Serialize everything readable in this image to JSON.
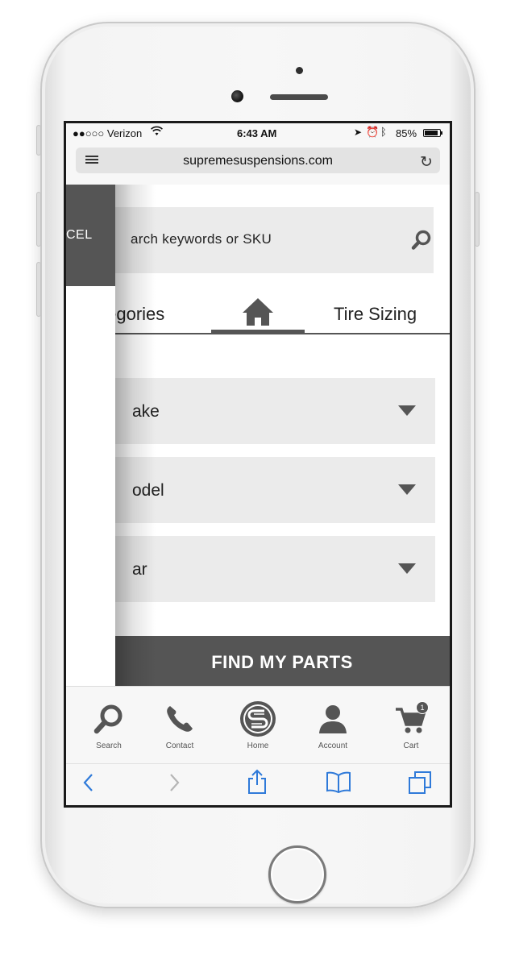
{
  "status_bar": {
    "carrier": "●●○○○ Verizon",
    "time": "6:43 AM",
    "battery": "85%"
  },
  "browser": {
    "url": "supremesuspensions.com"
  },
  "sidebar": {
    "cancel_label": "CEL"
  },
  "search": {
    "placeholder": "arch keywords or SKU"
  },
  "tabs": {
    "categories": "tegories",
    "home_icon": "home-icon",
    "tire_sizing": "Tire Sizing"
  },
  "selects": [
    {
      "label": "ake"
    },
    {
      "label": "odel"
    },
    {
      "label": "ar"
    }
  ],
  "find_button": "FIND MY PARTS",
  "app_nav": [
    {
      "label": "Search",
      "icon": "search-icon"
    },
    {
      "label": "Contact",
      "icon": "phone-icon"
    },
    {
      "label": "Home",
      "icon": "logo-icon"
    },
    {
      "label": "Account",
      "icon": "user-icon"
    },
    {
      "label": "Cart",
      "icon": "cart-icon",
      "badge": "1"
    }
  ],
  "colors": {
    "dark_gray": "#555555",
    "field_gray": "#ebebeb",
    "ios_blue": "#2f7ad9"
  }
}
